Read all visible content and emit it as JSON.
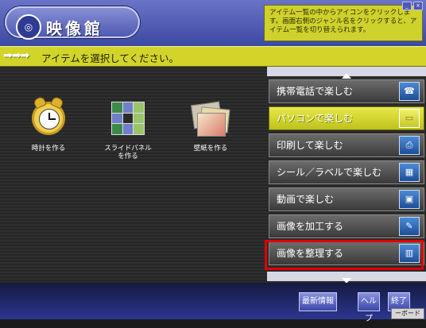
{
  "window": {
    "title": "映像館",
    "controls": [
      "_",
      "×"
    ]
  },
  "help": {
    "text": "アイテム一覧の中からアイコンをクリックします。画面右側のジャンル名をクリックすると、アイテム一覧を切り替えられます。"
  },
  "instruction": {
    "arrows": "➡➡➡",
    "text": "アイテムを選択してください。"
  },
  "items": [
    {
      "label": "時計を作る",
      "icon": "clock-icon"
    },
    {
      "label": "スライドパネル\nを作る",
      "icon": "slide-panel-icon"
    },
    {
      "label": "壁紙を作る",
      "icon": "wallpaper-icon"
    }
  ],
  "menu": {
    "items": [
      {
        "label": "携帯電話で楽しむ",
        "icon": "phone-icon",
        "active": false
      },
      {
        "label": "パソコンで楽しむ",
        "icon": "pc-icon",
        "active": true
      },
      {
        "label": "印刷して楽しむ",
        "icon": "printer-icon",
        "active": false
      },
      {
        "label": "シール／ラベルで楽しむ",
        "icon": "sticker-icon",
        "active": false
      },
      {
        "label": "動画で楽しむ",
        "icon": "video-icon",
        "active": false
      },
      {
        "label": "画像を加工する",
        "icon": "edit-image-icon",
        "active": false
      },
      {
        "label": "画像を整理する",
        "icon": "organize-icon",
        "active": false
      }
    ]
  },
  "bottom": {
    "latest_label": "最新情報",
    "help_label": "ヘルプ",
    "exit_label": "終了",
    "status_text": "ーボード"
  }
}
